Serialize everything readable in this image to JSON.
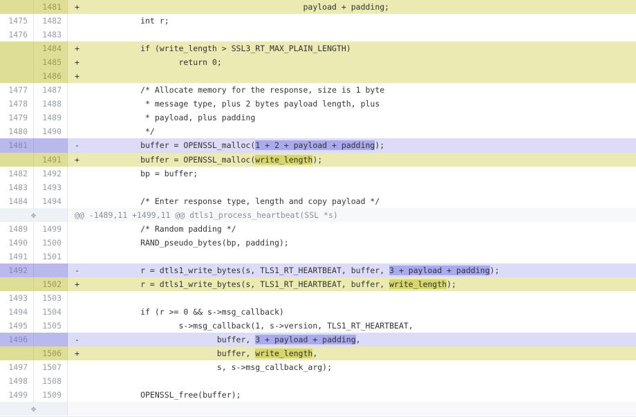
{
  "diff": {
    "rows": [
      {
        "type": "add",
        "old": "",
        "new": "1481",
        "marker": "+",
        "segs": [
          {
            "t": "                                              payload + padding;"
          }
        ]
      },
      {
        "type": "context",
        "old": "1475",
        "new": "1482",
        "marker": "",
        "segs": [
          {
            "t": "            int r;"
          }
        ]
      },
      {
        "type": "context",
        "old": "1476",
        "new": "1483",
        "marker": "",
        "segs": [
          {
            "t": ""
          }
        ]
      },
      {
        "type": "add",
        "old": "",
        "new": "1484",
        "marker": "+",
        "segs": [
          {
            "t": "            if (write_length > SSL3_RT_MAX_PLAIN_LENGTH)"
          }
        ]
      },
      {
        "type": "add",
        "old": "",
        "new": "1485",
        "marker": "+",
        "segs": [
          {
            "t": "                    return 0;"
          }
        ]
      },
      {
        "type": "add",
        "old": "",
        "new": "1486",
        "marker": "+",
        "segs": [
          {
            "t": ""
          }
        ]
      },
      {
        "type": "context",
        "old": "1477",
        "new": "1487",
        "marker": "",
        "segs": [
          {
            "t": "            /* Allocate memory for the response, size is 1 byte"
          }
        ]
      },
      {
        "type": "context",
        "old": "1478",
        "new": "1488",
        "marker": "",
        "segs": [
          {
            "t": "             * message type, plus 2 bytes payload length, plus"
          }
        ]
      },
      {
        "type": "context",
        "old": "1479",
        "new": "1489",
        "marker": "",
        "segs": [
          {
            "t": "             * payload, plus padding"
          }
        ]
      },
      {
        "type": "context",
        "old": "1480",
        "new": "1490",
        "marker": "",
        "segs": [
          {
            "t": "             */"
          }
        ]
      },
      {
        "type": "del",
        "old": "1481",
        "new": "",
        "marker": "-",
        "segs": [
          {
            "t": "            buffer = OPENSSL_malloc("
          },
          {
            "t": "1 + 2 + payload + padding",
            "hl": true
          },
          {
            "t": ");"
          }
        ]
      },
      {
        "type": "add",
        "old": "",
        "new": "1491",
        "marker": "+",
        "segs": [
          {
            "t": "            buffer = OPENSSL_malloc("
          },
          {
            "t": "write_length",
            "hl": true
          },
          {
            "t": ");"
          }
        ]
      },
      {
        "type": "context",
        "old": "1482",
        "new": "1492",
        "marker": "",
        "segs": [
          {
            "t": "            bp = buffer;"
          }
        ]
      },
      {
        "type": "context",
        "old": "1483",
        "new": "1493",
        "marker": "",
        "segs": [
          {
            "t": ""
          }
        ]
      },
      {
        "type": "context",
        "old": "1484",
        "new": "1494",
        "marker": "",
        "segs": [
          {
            "t": "            /* Enter response type, length and copy payload */"
          }
        ]
      },
      {
        "type": "hunk",
        "text": "@@ -1489,11 +1499,11 @@ dtls1_process_heartbeat(SSL *s)"
      },
      {
        "type": "context",
        "old": "1489",
        "new": "1499",
        "marker": "",
        "segs": [
          {
            "t": "            /* Random padding */"
          }
        ]
      },
      {
        "type": "context",
        "old": "1490",
        "new": "1500",
        "marker": "",
        "segs": [
          {
            "t": "            RAND_pseudo_bytes(bp, padding);"
          }
        ]
      },
      {
        "type": "context",
        "old": "1491",
        "new": "1501",
        "marker": "",
        "segs": [
          {
            "t": ""
          }
        ]
      },
      {
        "type": "del",
        "old": "1492",
        "new": "",
        "marker": "-",
        "segs": [
          {
            "t": "            r = dtls1_write_bytes(s, TLS1_RT_HEARTBEAT, buffer, "
          },
          {
            "t": "3 + payload + padding",
            "hl": true
          },
          {
            "t": ");"
          }
        ]
      },
      {
        "type": "add",
        "old": "",
        "new": "1502",
        "marker": "+",
        "segs": [
          {
            "t": "            r = dtls1_write_bytes(s, TLS1_RT_HEARTBEAT, buffer, "
          },
          {
            "t": "write_length",
            "hl": true
          },
          {
            "t": ");"
          }
        ]
      },
      {
        "type": "context",
        "old": "1493",
        "new": "1503",
        "marker": "",
        "segs": [
          {
            "t": ""
          }
        ]
      },
      {
        "type": "context",
        "old": "1494",
        "new": "1504",
        "marker": "",
        "segs": [
          {
            "t": "            if (r >= 0 && s->msg_callback)"
          }
        ]
      },
      {
        "type": "context",
        "old": "1495",
        "new": "1505",
        "marker": "",
        "segs": [
          {
            "t": "                    s->msg_callback(1, s->version, TLS1_RT_HEARTBEAT,"
          }
        ]
      },
      {
        "type": "del",
        "old": "1496",
        "new": "",
        "marker": "-",
        "segs": [
          {
            "t": "                            buffer, "
          },
          {
            "t": "3 + payload + padding",
            "hl": true
          },
          {
            "t": ","
          }
        ]
      },
      {
        "type": "add",
        "old": "",
        "new": "1506",
        "marker": "+",
        "segs": [
          {
            "t": "                            buffer, "
          },
          {
            "t": "write_length",
            "hl": true
          },
          {
            "t": ","
          }
        ]
      },
      {
        "type": "context",
        "old": "1497",
        "new": "1507",
        "marker": "",
        "segs": [
          {
            "t": "                            s, s->msg_callback_arg);"
          }
        ]
      },
      {
        "type": "context",
        "old": "1498",
        "new": "1508",
        "marker": "",
        "segs": [
          {
            "t": ""
          }
        ]
      },
      {
        "type": "context",
        "old": "1499",
        "new": "1509",
        "marker": "",
        "segs": [
          {
            "t": "            OPENSSL_free(buffer);"
          }
        ]
      },
      {
        "type": "hunk",
        "text": ""
      }
    ]
  },
  "icons": {
    "expand": "expand-arrows-icon"
  },
  "colors": {
    "add_line": "#eaeab2",
    "add_gutter": "#dede97",
    "del_line": "#dcdcf8",
    "del_gutter": "#b9b9ee"
  }
}
